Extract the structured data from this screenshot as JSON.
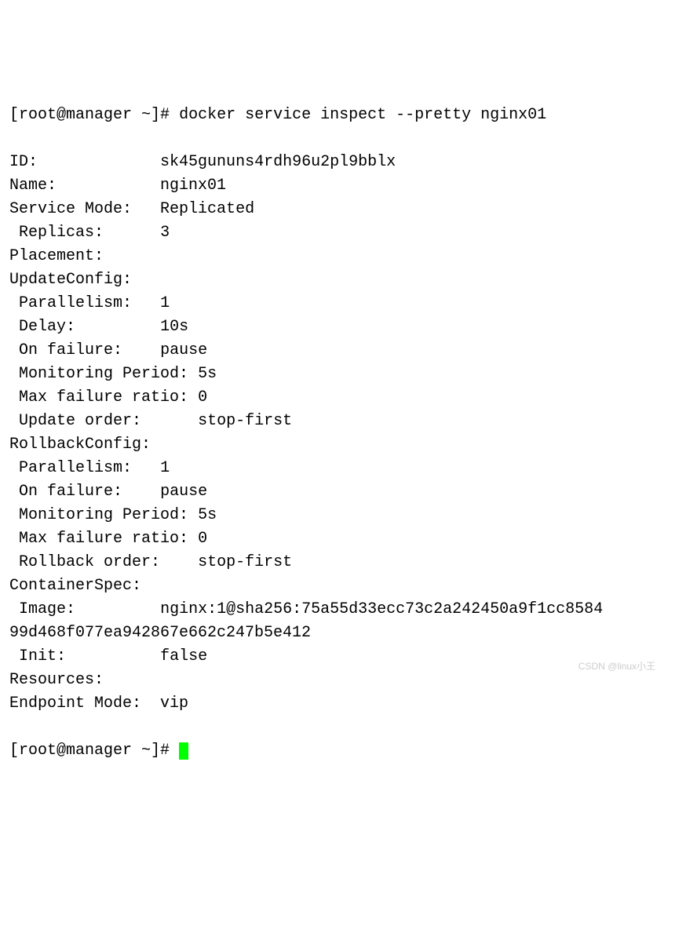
{
  "prompt1": {
    "user_host": "[root@manager ~]#",
    "command": "docker service inspect --pretty nginx01"
  },
  "output": {
    "id_label": "ID:",
    "id_value": "sk45gununs4rdh96u2pl9bblx",
    "name_label": "Name:",
    "name_value": "nginx01",
    "mode_label": "Service Mode:",
    "mode_value": "Replicated",
    "replicas_label": " Replicas:",
    "replicas_value": "3",
    "placement_label": "Placement:",
    "update_label": "UpdateConfig:",
    "u_par_label": " Parallelism:",
    "u_par_value": "1",
    "u_delay_label": " Delay:",
    "u_delay_value": "10s",
    "u_fail_label": " On failure:",
    "u_fail_value": "pause",
    "u_mon_label": " Monitoring Period:",
    "u_mon_value": "5s",
    "u_max_label": " Max failure ratio:",
    "u_max_value": "0",
    "u_order_label": " Update order:",
    "u_order_value": "stop-first",
    "rollback_label": "RollbackConfig:",
    "r_par_label": " Parallelism:",
    "r_par_value": "1",
    "r_fail_label": " On failure:",
    "r_fail_value": "pause",
    "r_mon_label": " Monitoring Period:",
    "r_mon_value": "5s",
    "r_max_label": " Max failure ratio:",
    "r_max_value": "0",
    "r_order_label": " Rollback order:",
    "r_order_value": "stop-first",
    "container_label": "ContainerSpec:",
    "image_label": " Image:",
    "image_value_l1": "nginx:1@sha256:75a55d33ecc73c2a242450a9f1cc8584",
    "image_value_l2": "99d468f077ea942867e662c247b5e412",
    "init_label": " Init:",
    "init_value": "false",
    "resources_label": "Resources:",
    "endpoint_label": "Endpoint Mode:",
    "endpoint_value": "vip"
  },
  "prompt2": {
    "user_host": "[root@manager ~]#"
  },
  "watermark": "CSDN @linux小王"
}
